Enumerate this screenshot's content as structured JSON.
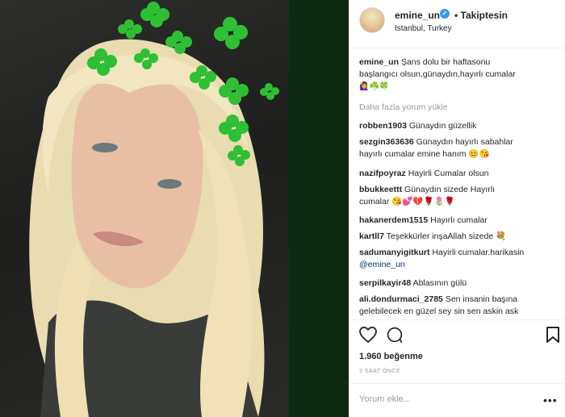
{
  "post": {
    "username": "emine_un",
    "verified_glyph": "✔",
    "follow_label": "• Takiptesin",
    "location": "Istanbul, Turkey",
    "caption_user": "emine_un",
    "caption_text_1": "Şans dolu bir haftasonu",
    "caption_text_2": "başlangıcı olsun,günaydın,hayırlı cumalar",
    "caption_emoji": "🙋‍♀️☘️🍀",
    "load_more": "Daha fazla yorum yükle"
  },
  "comments": [
    {
      "user": "robben1903",
      "text": "Günaydın güzellik",
      "text2": ""
    },
    {
      "user": "sezgin363636",
      "text": "Günaydın hayırlı sabahlar",
      "text2": "hayırlı cumalar emine hanım 😊😘"
    },
    {
      "user": "nazifpoyraz",
      "text": "Hayirli Cumalar olsun",
      "text2": ""
    },
    {
      "user": "bbukkeettt",
      "text": "Günaydın sizede Hayırlı",
      "text2": "cumalar 😘💕💔🌹🌷🌹"
    },
    {
      "user": "hakanerdem1515",
      "text": "Hayırlı cumalar",
      "text2": ""
    },
    {
      "user": "kartll7",
      "text": "Teşekkürler inşaAllah sizede 💐",
      "text2": ""
    },
    {
      "user": "sadumanyigitkurt",
      "text": "Hayirli cumalar.harikasin",
      "text2": "@emine_un"
    },
    {
      "user": "serpilkayir48",
      "text": "Ablasının gülü",
      "text2": ""
    },
    {
      "user": "ali.dondurmaci_2785",
      "text": "Sen insanin başına",
      "text2": "gelebilecek en güzel sey sin sen askin ask"
    }
  ],
  "actions": {
    "like_icon": "heart-icon",
    "comment_icon": "comment-icon",
    "save_icon": "bookmark-icon",
    "likes": "1.960 beğenme",
    "time": "3 SAAT ÖNCE",
    "add_comment_placeholder": "Yorum ekle...",
    "more_icon": "more-dots-icon",
    "more_glyph": "•••"
  },
  "colors": {
    "accent": "#3897f0",
    "muted": "#999999",
    "clover": "#2fbf34"
  }
}
